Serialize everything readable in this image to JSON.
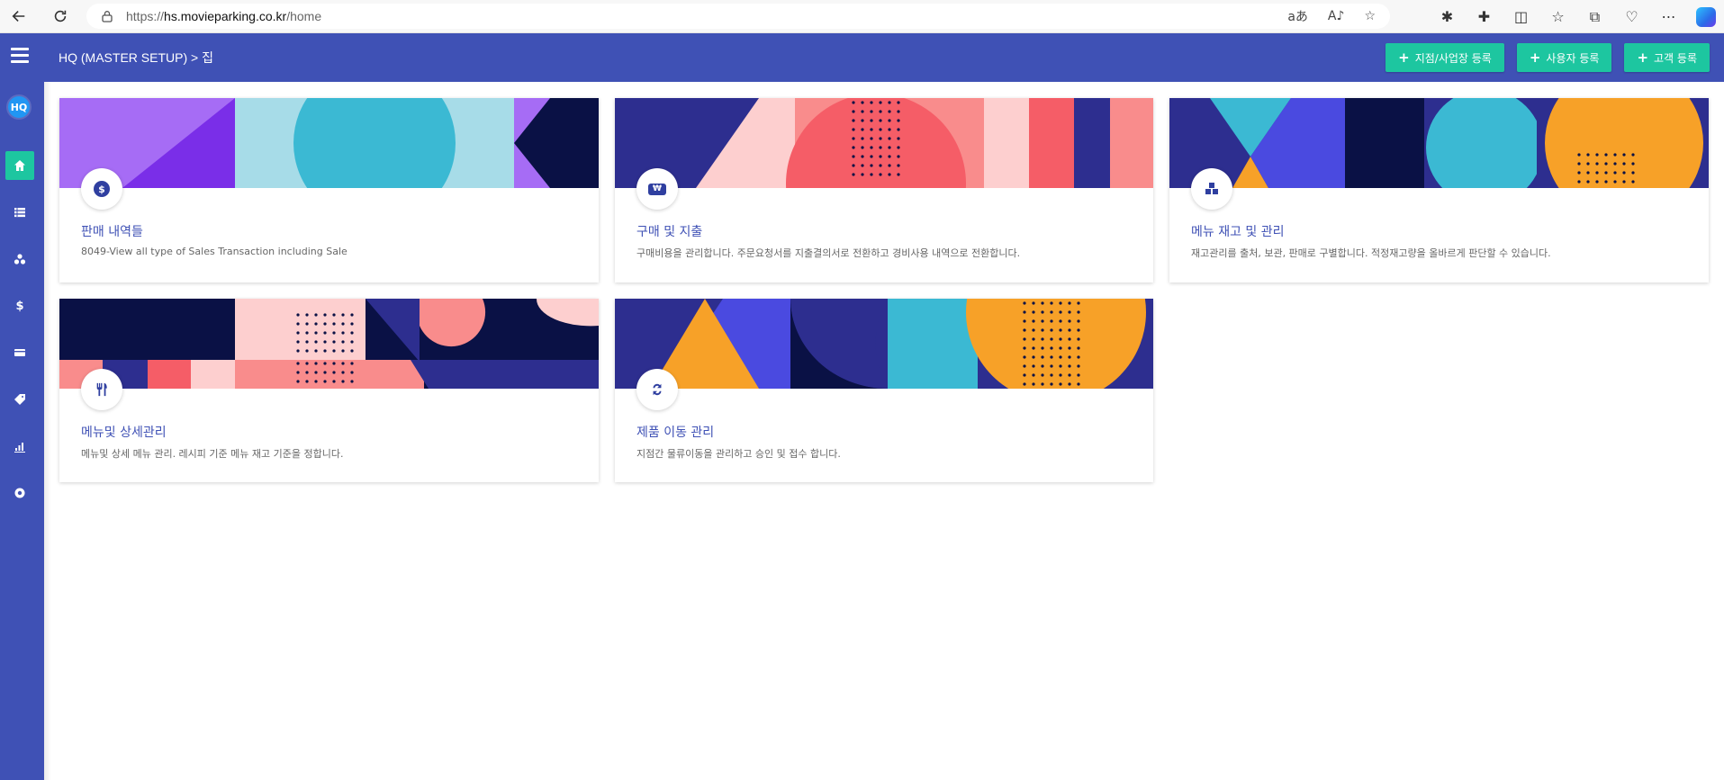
{
  "browser": {
    "url_proto": "https://",
    "url_host": "hs.movieparking.co.kr",
    "url_path": "/home",
    "addr_icons": [
      "translate-icon",
      "read-aloud-icon",
      "favorite-star-icon"
    ],
    "ext_icons": [
      "extension-bug-icon",
      "extensions-icon",
      "split-screen-icon",
      "favorites-icon",
      "collections-icon",
      "performance-icon",
      "more-icon",
      "copilot-icon"
    ]
  },
  "header": {
    "breadcrumb": "HQ (MASTER SETUP) > 집",
    "buttons": [
      {
        "label": "지점/사업장 등록"
      },
      {
        "label": "사용자 등록"
      },
      {
        "label": "고객 등록"
      }
    ],
    "accent": "#3f51b5",
    "button_color": "#1dc6a0"
  },
  "sidebar": {
    "avatar": "HQ",
    "items": [
      {
        "name": "home-icon"
      },
      {
        "name": "list-icon"
      },
      {
        "name": "boxes-icon"
      },
      {
        "name": "dollar-icon"
      },
      {
        "name": "card-icon"
      },
      {
        "name": "tag-icon"
      },
      {
        "name": "chart-icon"
      },
      {
        "name": "settings-icon"
      }
    ]
  },
  "cards": [
    {
      "title": "판매 내역들",
      "desc": "8049-View all type of Sales Transaction including Sale",
      "icon": "dollar-icon"
    },
    {
      "title": "구매 및 지출",
      "desc": "구매비용을 관리합니다. 주문요청서를 지출결의서로 전환하고 경비사용 내역으로 전환합니다.",
      "icon": "money-icon"
    },
    {
      "title": "메뉴 재고 및 관리",
      "desc": "재고관리를 출처, 보관, 판매로 구별합니다. 적정재고량을 올바르게 판단할 수 있습니다.",
      "icon": "cubes-icon"
    },
    {
      "title": "메뉴및 상세관리",
      "desc": "메뉴및 상세 메뉴 관리. 레시피 기준 메뉴 재고 기준을 정합니다.",
      "icon": "utensils-icon"
    },
    {
      "title": "제품 이동 관리",
      "desc": "지점간 물류이동을 관리하고 승인 및 접수 합니다.",
      "icon": "transfer-icon"
    }
  ]
}
